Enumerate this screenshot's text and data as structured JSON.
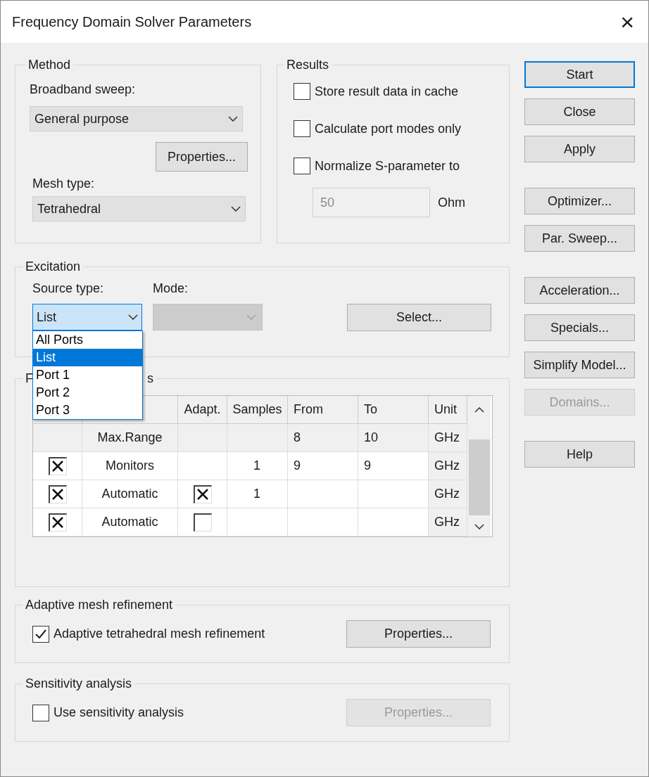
{
  "window": {
    "title": "Frequency Domain Solver Parameters",
    "close": "×"
  },
  "method": {
    "title": "Method",
    "broadband_label": "Broadband sweep:",
    "broadband_value": "General purpose",
    "properties_button": "Properties...",
    "mesh_label": "Mesh type:",
    "mesh_value": "Tetrahedral"
  },
  "results": {
    "title": "Results",
    "options": [
      {
        "label": "Store result data in cache",
        "checked": false
      },
      {
        "label": "Calculate port modes only",
        "checked": false
      },
      {
        "label": "Normalize S-parameter to",
        "checked": false
      }
    ],
    "impedance": {
      "value": "50",
      "disabled": true
    },
    "impedance_unit": "Ohm"
  },
  "excitation": {
    "title": "Excitation",
    "source_label": "Source type:",
    "source_value": "List",
    "expanded": true,
    "source_options": [
      {
        "label": "All Ports",
        "selected": false
      },
      {
        "label": "List",
        "selected": true
      },
      {
        "label": "Port 1",
        "selected": false
      },
      {
        "label": "Port 2",
        "selected": false
      },
      {
        "label": "Port 3",
        "selected": false
      }
    ],
    "mode_label": "Mode:",
    "mode_disabled": true,
    "select_button": "Select..."
  },
  "frequency_samples": {
    "title_visible_start": "F",
    "title_visible_end": "s",
    "columns": [
      "Adapt.",
      "Samples",
      "From",
      "To",
      "Unit"
    ],
    "rows": [
      {
        "kind": "range",
        "type": "Max.Range",
        "from": "8",
        "to": "10",
        "unit": "GHz"
      },
      {
        "kind": "entry",
        "checked": true,
        "type": "Monitors",
        "samples": "1",
        "from": "9",
        "to": "9",
        "unit": "GHz"
      },
      {
        "kind": "entry",
        "checked": true,
        "type": "Automatic",
        "adapt": true,
        "samples": "1",
        "unit": "GHz"
      },
      {
        "kind": "entry",
        "checked": true,
        "type": "Automatic",
        "adapt": false,
        "unit": "GHz"
      }
    ]
  },
  "adaptive": {
    "title": "Adaptive mesh refinement",
    "option": {
      "label": "Adaptive tetrahedral mesh refinement",
      "checked": true
    },
    "properties_button": {
      "label": "Properties...",
      "disabled": false
    }
  },
  "sensitivity": {
    "title": "Sensitivity analysis",
    "option": {
      "label": "Use sensitivity analysis",
      "checked": false
    },
    "properties_button": {
      "label": "Properties...",
      "disabled": true
    }
  },
  "button_groups": [
    [
      {
        "label": "Start",
        "default": true,
        "disabled": false
      },
      {
        "label": "Close",
        "default": false,
        "disabled": false
      },
      {
        "label": "Apply",
        "default": false,
        "disabled": false
      }
    ],
    [
      {
        "label": "Optimizer...",
        "default": false,
        "disabled": false
      },
      {
        "label": "Par. Sweep...",
        "default": false,
        "disabled": false
      }
    ],
    [
      {
        "label": "Acceleration...",
        "default": false,
        "disabled": false
      },
      {
        "label": "Specials...",
        "default": false,
        "disabled": false
      },
      {
        "label": "Simplify Model...",
        "default": false,
        "disabled": false
      },
      {
        "label": "Domains...",
        "default": false,
        "disabled": true
      }
    ],
    [
      {
        "label": "Help",
        "default": false,
        "disabled": false
      }
    ]
  ]
}
